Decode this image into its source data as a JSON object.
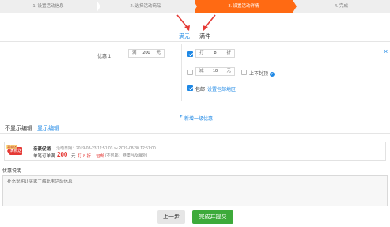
{
  "steps": [
    {
      "label": "1. 设置活动信息",
      "state": "done"
    },
    {
      "label": "2. 选择活动商品",
      "state": "done"
    },
    {
      "label": "3. 设置活动详情",
      "state": "active"
    },
    {
      "label": "4. 完成",
      "state": "todo"
    }
  ],
  "mode_tabs": {
    "tab1": "满元",
    "tab2": "满件",
    "active": "满元"
  },
  "tier": {
    "label": "优惠 1",
    "threshold": {
      "prefix": "满",
      "value": "200",
      "suffix": "元"
    },
    "discount": {
      "checked": true,
      "prefix": "打",
      "value": "8",
      "suffix": "折"
    },
    "reduce": {
      "checked": false,
      "prefix": "减",
      "value": "10",
      "suffix": "元"
    },
    "no_cap": {
      "checked": false,
      "label": "上不封顶",
      "help": "?"
    },
    "free_shipping": {
      "checked": true,
      "label": "包邮",
      "link": "设置包邮地区"
    },
    "close": "×"
  },
  "add_tier": {
    "icon": "+",
    "label": "新增一级优惠"
  },
  "view_tabs": {
    "tab1": "不显示编辑",
    "tab2": "显示编辑",
    "active": "显示编辑"
  },
  "preview": {
    "badge_tag": "满就送",
    "badge": "满就送",
    "title": "亲豪促销",
    "date_text": "活动日期：2019-08-23 12:51:03 ～ 2019-08-30 12:51:00",
    "line_prefix": "单笔订单满",
    "amount": "200",
    "unit": "元",
    "discount_text": "打 8 折",
    "shipping": "包邮",
    "note": "(不包邮：港澳台及海外)"
  },
  "description": {
    "label": "优惠说明",
    "placeholder_text": "补充说明让买家了解此宝活动信息"
  },
  "buttons": {
    "prev": "上一步",
    "submit": "完成并提交"
  },
  "colors": {
    "accent": "#1e88e5",
    "active_step": "#ff6a13",
    "submit": "#3daa3a",
    "price": "#e53935"
  }
}
